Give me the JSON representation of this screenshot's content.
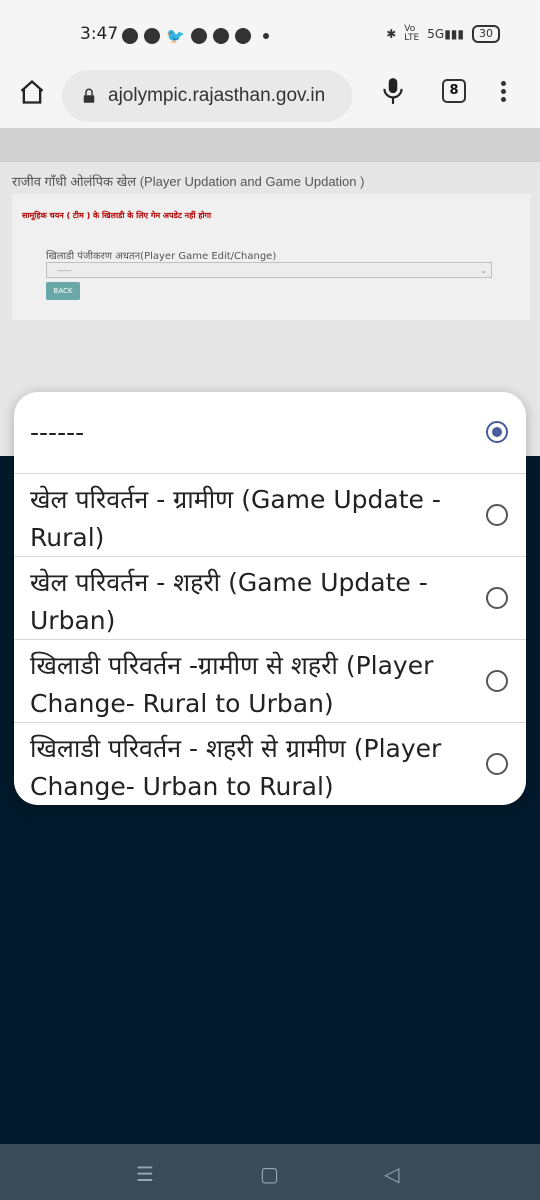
{
  "status_bar": {
    "time": "3:47",
    "battery": "30",
    "network": "5G"
  },
  "browser": {
    "url": "ajolympic.rajasthan.gov.in",
    "tab_count": "8"
  },
  "page": {
    "title": "राजीव गाँधी ओलंपिक खेल (Player Updation and Game Updation )",
    "warning": "सामूहिक चयन ( टीम ) के खिलाडी के लिए गेम अपडेट नहीं होगा",
    "field_label": "खिलाडी पंजीकरण अधतन(Player Game Edit/Change)",
    "select_value": "-----",
    "back_label": "BACK"
  },
  "dialog": {
    "options": [
      {
        "label": "------",
        "selected": true
      },
      {
        "label": "खेल परिवर्तन - ग्रामीण (Game Update -Rural)",
        "selected": false
      },
      {
        "label": "खेल परिवर्तन - शहरी (Game Update -Urban)",
        "selected": false
      },
      {
        "label": "खिलाडी परिवर्तन -ग्रामीण से शहरी (Player Change- Rural to Urban)",
        "selected": false
      },
      {
        "label": "खिलाडी परिवर्तन - शहरी से ग्रामीण (Player Change- Urban to Rural)",
        "selected": false
      }
    ],
    "accent_color": "#4a5c9b"
  }
}
